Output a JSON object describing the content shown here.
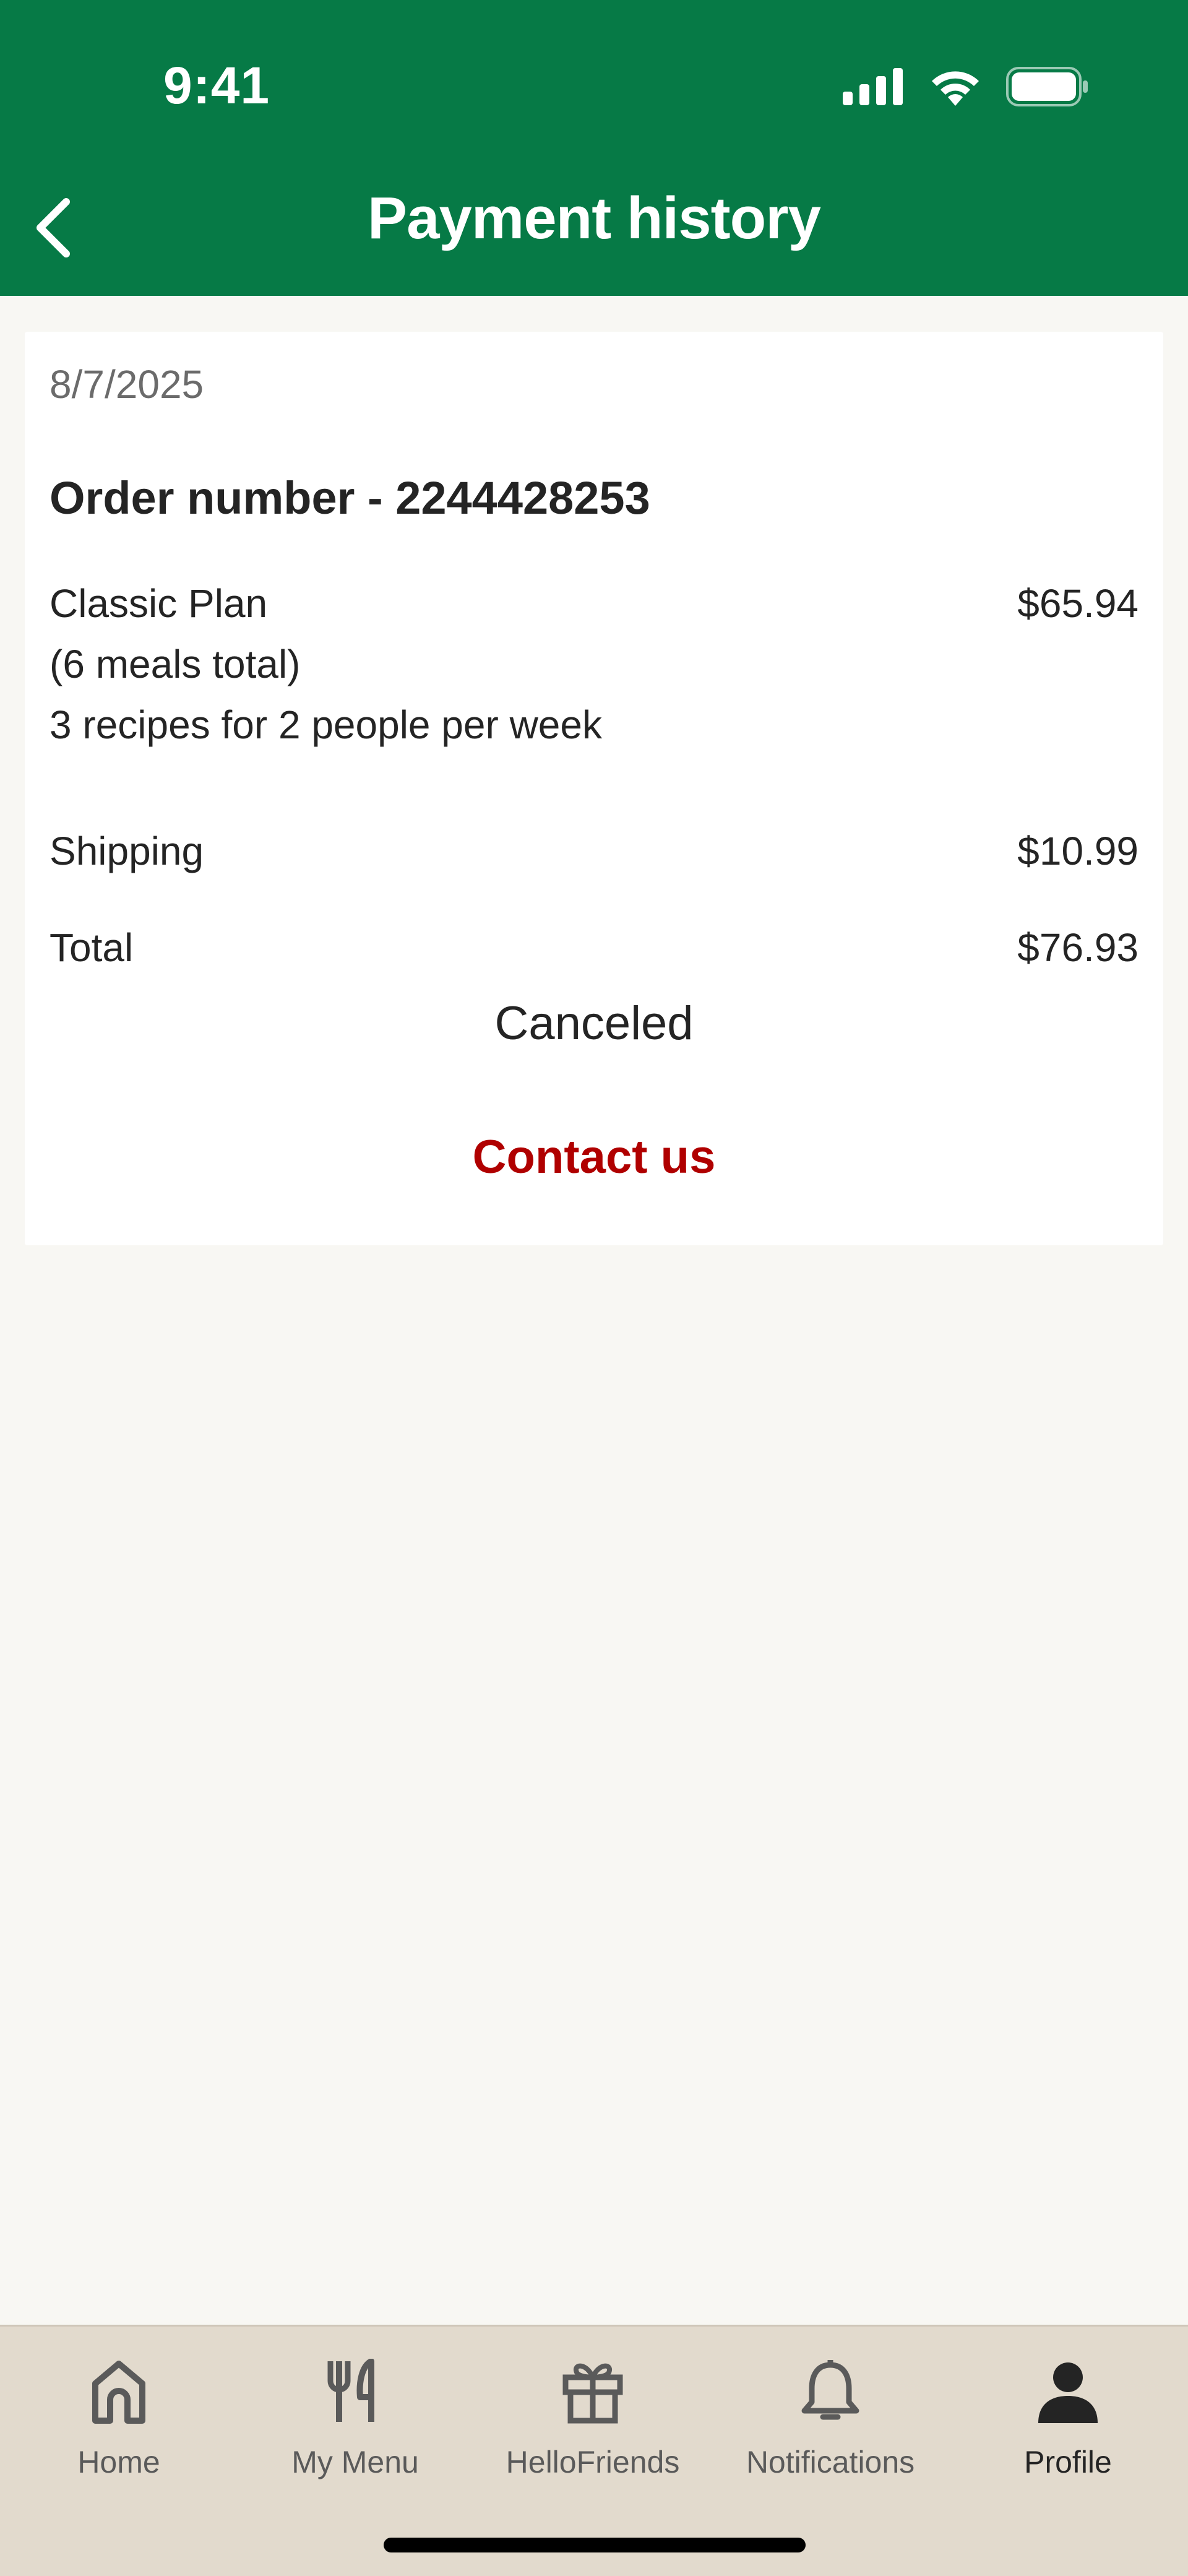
{
  "status_bar": {
    "time": "9:41",
    "icons": [
      "cellular-signal-icon",
      "wifi-icon",
      "battery-icon"
    ]
  },
  "header": {
    "title": "Payment history",
    "back_icon": "chevron-left-icon",
    "background_color": "#067a46"
  },
  "order": {
    "date": "8/7/2025",
    "order_number": "Order number - 2244428253",
    "plan": {
      "lines": [
        "Classic Plan",
        "(6 meals total)",
        "3 recipes for 2 people per week"
      ],
      "amount": "$65.94"
    },
    "shipping": {
      "label": "Shipping",
      "amount": "$10.99"
    },
    "total": {
      "label": "Total",
      "amount": "$76.93"
    },
    "status": "Canceled",
    "contact_label": "Contact us",
    "contact_color": "#b00000"
  },
  "tabbar": {
    "items": [
      {
        "label": "Home",
        "icon": "home-icon",
        "active": false
      },
      {
        "label": "My Menu",
        "icon": "fork-knife-icon",
        "active": false
      },
      {
        "label": "HelloFriends",
        "icon": "gift-icon",
        "active": false
      },
      {
        "label": "Notifications",
        "icon": "bell-icon",
        "active": false
      },
      {
        "label": "Profile",
        "icon": "person-icon",
        "active": true
      }
    ]
  }
}
